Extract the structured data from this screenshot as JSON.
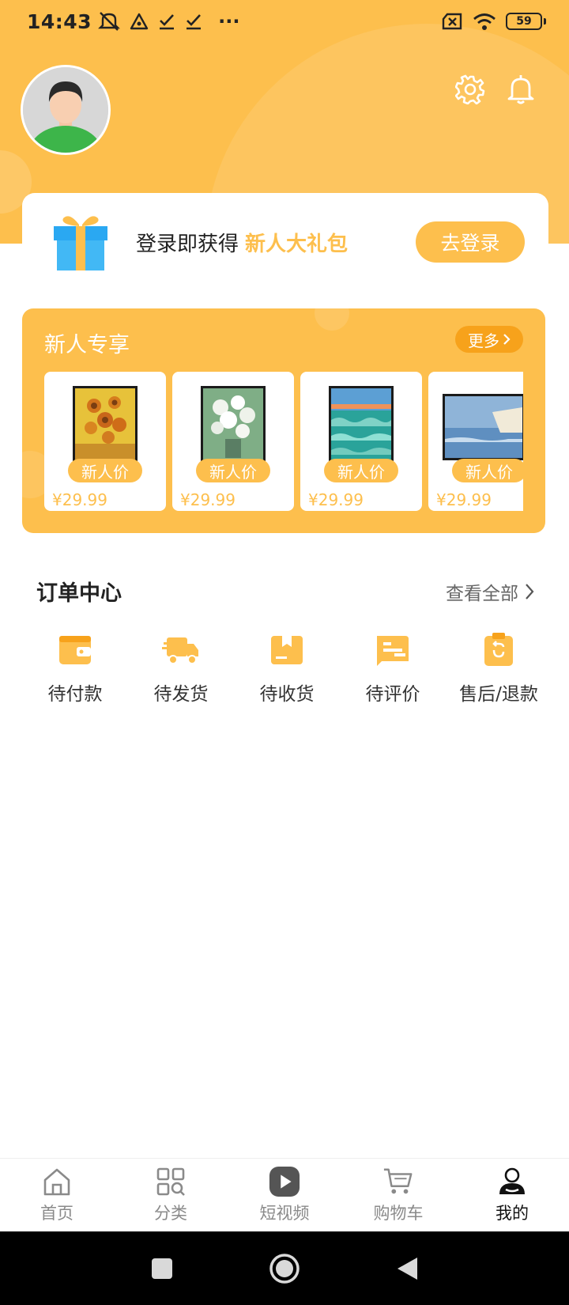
{
  "status_bar": {
    "time": "14:43",
    "battery": "59",
    "dots": "···"
  },
  "login_card": {
    "text": "登录即获得",
    "highlight": "新人大礼包",
    "button": "去登录"
  },
  "new_user": {
    "title": "新人专享",
    "more": "更多",
    "products": [
      {
        "tag": "新人价",
        "price": "¥29.99",
        "art": "sunflowers"
      },
      {
        "tag": "新人价",
        "price": "¥29.99",
        "art": "white-flowers"
      },
      {
        "tag": "新人价",
        "price": "¥29.99",
        "art": "seascape"
      },
      {
        "tag": "新人价",
        "price": "¥29.99",
        "art": "cliffs"
      }
    ]
  },
  "orders": {
    "title": "订单中心",
    "view_all": "查看全部",
    "items": [
      {
        "label": "待付款",
        "icon": "wallet-icon"
      },
      {
        "label": "待发货",
        "icon": "truck-icon"
      },
      {
        "label": "待收货",
        "icon": "package-icon"
      },
      {
        "label": "待评价",
        "icon": "review-icon"
      },
      {
        "label": "售后/退款",
        "icon": "refund-icon"
      }
    ]
  },
  "tabbar": {
    "items": [
      {
        "label": "首页",
        "icon": "home-icon"
      },
      {
        "label": "分类",
        "icon": "category-icon"
      },
      {
        "label": "短视频",
        "icon": "video-icon"
      },
      {
        "label": "购物车",
        "icon": "cart-icon"
      },
      {
        "label": "我的",
        "icon": "profile-icon"
      }
    ],
    "active": "我的"
  },
  "colors": {
    "accent": "#fdbf4d",
    "accent_dark": "#f7a21b",
    "text": "#222222",
    "muted": "#8a8a8a"
  }
}
